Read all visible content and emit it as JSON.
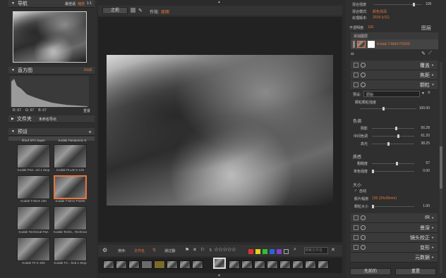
{
  "navigator": {
    "title": "导航",
    "opt1": "最佳适",
    "opt2": "缩放",
    "opt3": "1:1"
  },
  "histogram": {
    "title": "直方图",
    "mode": "RGB",
    "r": "R: 67",
    "g": "G: 67",
    "b": "B: 67",
    "reset": "重置"
  },
  "folder": {
    "title": "文件夹",
    "value": "未命名导出"
  },
  "presets": {
    "title": "预设",
    "toprow": [
      "Ilford XP2 Super",
      "Kodak Panatomic-X"
    ],
    "items": [
      "Kodak Port...ird 1 Stop",
      "Kodak PLUS-X 125",
      "Kodak T-MAX 100",
      "Kodak T-MAX P3200",
      "Kodak Technical Pan",
      "Kodak Techn...Technical",
      "Kodak Tri-X 400",
      "Kodak Tri-...hed 1 Stop"
    ]
  },
  "toolbar": {
    "before": "之前",
    "works": "作效:",
    "works_val": "原图"
  },
  "filmstrip_bar": {
    "sort": "排序:",
    "sort_val": "文件名",
    "filter": "通过器:",
    "count": "5",
    "search_placeholder": "搜索文件名"
  },
  "right_top": {
    "opacity_label": "混合强度",
    "opacity_val": "100",
    "blend_label": "混合模式:",
    "blend_val": "颜色加深",
    "process_label": "处理版本:",
    "process_val": "2018 (v11)",
    "opaque_label": "不透明度:",
    "opaque_val": "100",
    "layers_title": "图层",
    "add_layer": "添加图层",
    "layer_name": "Kodak T-MAX P3200"
  },
  "sections": {
    "overlay": "覆盖",
    "crop": "焦距",
    "grain": "颗粒",
    "ir": "IR",
    "light": "景深",
    "lens": "镜头校正",
    "transform": "变形",
    "meta": "元数据"
  },
  "grain": {
    "preset_label": "预设:",
    "preset_val": "原始",
    "overall_label": "颗粒颗粒强度",
    "overall_val": "100.00",
    "tone_title": "色调",
    "shadow_label": "阴影",
    "shadow_val": "56.28",
    "mid_label": "中间色调",
    "mid_val": "61.20",
    "high_label": "高光",
    "high_val": "38.25",
    "grain_title": "质感",
    "rough_label": "粗糙度",
    "rough_val": "57",
    "mono_label": "单色强度",
    "mono_val": "0.00",
    "size_title": "大小",
    "auto_label": "自动",
    "film_label": "胶片幅度:",
    "film_val": "135 (24x36mm)",
    "grain_size_label": "颗粒大小",
    "grain_size_val": "1.00"
  },
  "bottom_buttons": {
    "prev": "先前的",
    "reset": "重置"
  },
  "colors": {
    "accent": "#e8743b",
    "red": "#e03030",
    "yellow": "#e0d020",
    "green": "#30c030",
    "blue": "#3060e0",
    "purple": "#8040d0"
  }
}
